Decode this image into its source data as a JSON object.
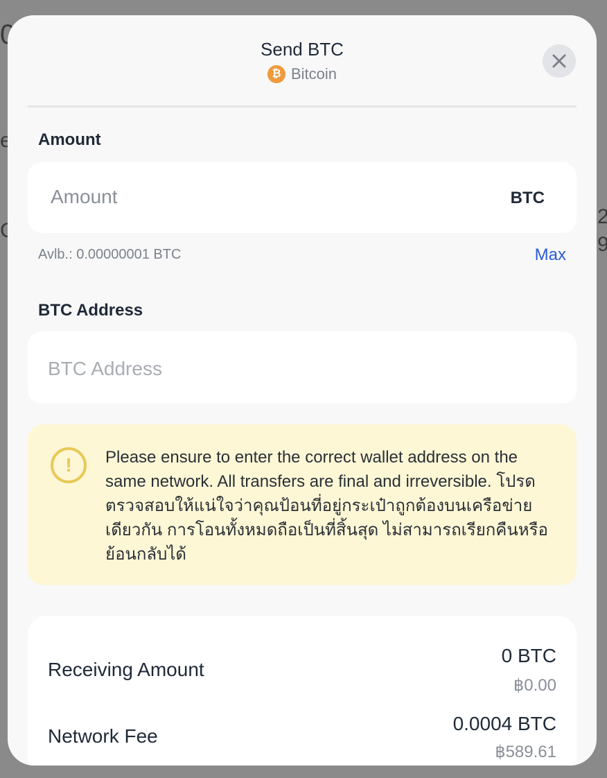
{
  "modal": {
    "title": "Send BTC",
    "subtitle": "Bitcoin",
    "coin_symbol": "₿"
  },
  "amount": {
    "label": "Amount",
    "placeholder": "Amount",
    "unit": "BTC",
    "available": "Avlb.: 0.00000001 BTC",
    "max_label": "Max"
  },
  "address": {
    "label": "BTC Address",
    "placeholder": "BTC Address"
  },
  "warning": {
    "icon": "!",
    "text": "Please ensure to enter the correct wallet address on the same network. All transfers are final and irreversible. โปรดตรวจสอบให้แน่ใจว่าคุณป้อนที่อยู่กระเป๋าถูกต้องบนเครือข่ายเดียวกัน การโอนทั้งหมดถือเป็นที่สิ้นสุด ไม่สามารถเรียกคืนหรือย้อนกลับได้"
  },
  "summary": {
    "receiving_label": "Receiving Amount",
    "receiving_value": "0 BTC",
    "receiving_fiat": "฿0.00",
    "fee_label": "Network Fee",
    "fee_value": "0.0004 BTC",
    "fee_fiat": "฿589.61"
  },
  "colors": {
    "accent": "#2a5bd7",
    "bitcoin": "#ef9a3c",
    "warning_bg": "#fdf7d6",
    "warning_icon": "#e8c957"
  }
}
